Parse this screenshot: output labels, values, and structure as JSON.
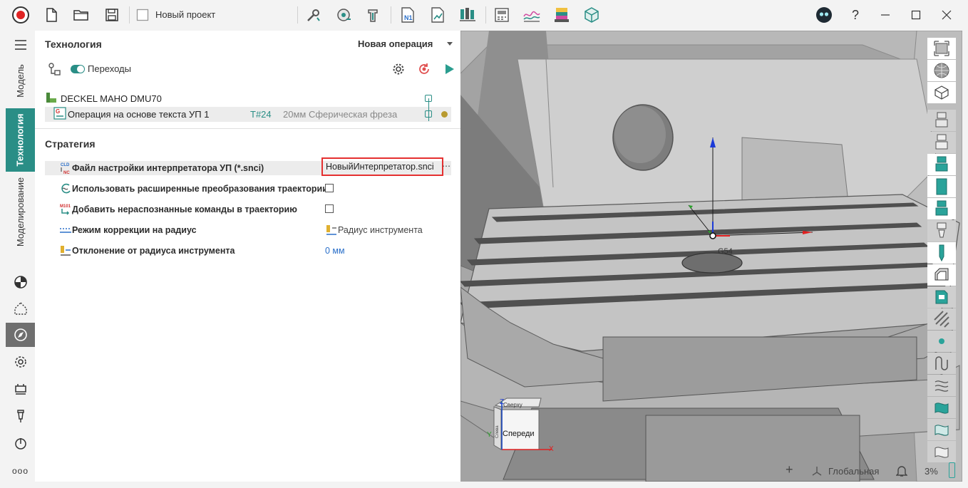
{
  "app": {
    "project_title": "Новый проект",
    "help_label": "?",
    "colors": {
      "accent": "#2a8e86",
      "highlight_border": "#e53030",
      "link_blue": "#2a6fc9"
    }
  },
  "rail": {
    "tabs": [
      {
        "label": "Модель"
      },
      {
        "label": "Технология"
      },
      {
        "label": "Моделирование"
      }
    ],
    "more_label": "ooo"
  },
  "panel": {
    "title": "Технология",
    "new_operation": "Новая операция",
    "transitions_label": "Переходы",
    "tree": {
      "machine": "DECKEL MAHO DMU70",
      "operation": "Операция на основе текста УП 1",
      "tool_number": "T#24",
      "tool_name": "20мм Сферическая фреза"
    },
    "strategy": {
      "title": "Стратегия",
      "props": [
        {
          "label": "Файл настройки интерпретатора УП (*.snci)",
          "value": "НовыйИнтерпретатор.snci",
          "icon_text": "CLD NC"
        },
        {
          "label": "Использовать расширенные преобразования траектории",
          "checked": false
        },
        {
          "label": "Добавить нераспознанные команды в траекторию",
          "checked": false,
          "icon_text": "M101"
        },
        {
          "label": "Режим коррекции на радиус",
          "value": "Радиус инструмента"
        },
        {
          "label": "Отклонение от радиуса инструмента",
          "value": "0 мм"
        }
      ]
    }
  },
  "viewport": {
    "csys_label": "G54",
    "view_cube": {
      "top": "Сверху",
      "front": "Спереди",
      "left": "Слева"
    },
    "axes": {
      "x": "X",
      "y": "Y",
      "z": "Z"
    },
    "status": {
      "coord_system": "Глобальная СК",
      "zoom": "3%"
    }
  }
}
